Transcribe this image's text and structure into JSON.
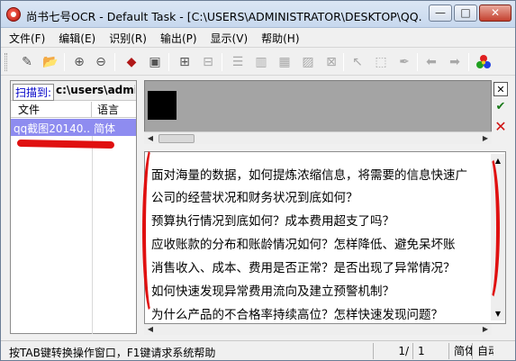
{
  "window": {
    "title": "尚书七号OCR - Default Task - [C:\\USERS\\ADMINISTRATOR\\DESKTOP\\QQ..."
  },
  "menu": [
    "文件(F)",
    "编辑(E)",
    "识别(R)",
    "输出(P)",
    "显示(V)",
    "帮助(H)"
  ],
  "left_panel": {
    "scan_label": "扫描到:",
    "scan_path": "c:\\users\\admi",
    "columns": [
      "文件",
      "语言"
    ],
    "rows": [
      {
        "file": "qq截图20140...",
        "lang": "简体"
      }
    ]
  },
  "text_view": {
    "lines": [
      "面对海量的数据，如何提炼浓缩信息，将需要的信息快速广",
      "公司的经营状况和财务状况到底如何？",
      "预算执行情况到底如何？成本费用超支了吗？",
      "应收账款的分布和账龄情况如何？怎样降低、避免呆坏账",
      "消售收入、成本、费用是否正常？是否出现了异常情况？",
      "如何快速发现异常费用流向及建立预警机制？",
      "为什么产品的不合格率持续高位？怎样快速发现问题？"
    ]
  },
  "status": {
    "message": "按TAB键转换操作窗口，F1键请求系统帮助",
    "page_current": "1/",
    "page_total": "1",
    "lang": "简体",
    "mode": "自动"
  },
  "colors": {
    "selection": "#8e8cf0",
    "annotation_red": "#e01010",
    "scan_label": "#0000c8"
  }
}
